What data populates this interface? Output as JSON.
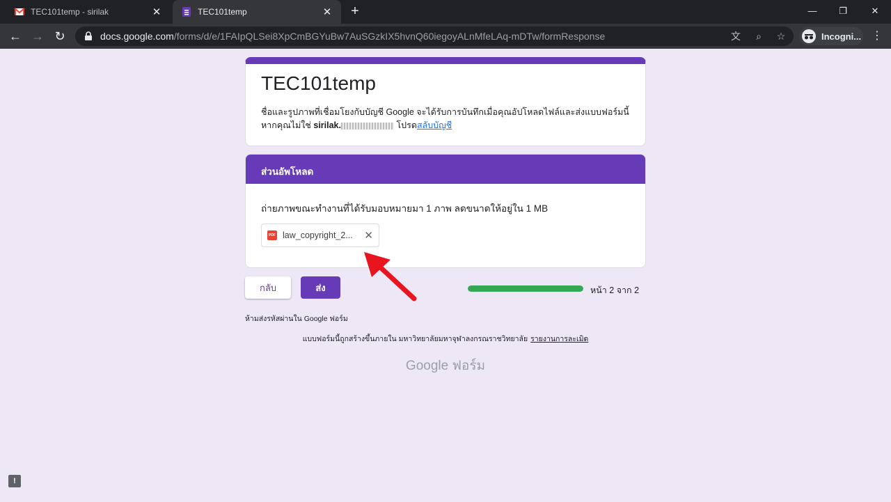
{
  "browser": {
    "tabs": [
      {
        "title": "TEC101temp - sirilak",
        "active": false
      },
      {
        "title": "TEC101temp",
        "active": true
      }
    ],
    "new_tab": "+",
    "url_host": "docs.google.com",
    "url_path": "/forms/d/e/1FAIpQLSei8XpCmBGYuBw7AuSGzkIX5hvnQ60iegoyALnMfeLAq-mDTw/formResponse",
    "profile_label": "Incogni..."
  },
  "form": {
    "title": "TEC101temp",
    "notice_line1": "ชื่อและรูปภาพที่เชื่อมโยงกับบัญชี Google จะได้รับการบันทึกเมื่อคุณอัปโหลดไฟล์และส่งแบบฟอร์มนี้",
    "notice_prefix": "หากคุณไม่ใช่ ",
    "notice_email": "sirilak.",
    "notice_suffix": " โปรด",
    "switch_account": "สลับบัญชี",
    "section_title": "ส่วนอัพโหลด",
    "question": "ถ่ายภาพขณะทำงานที่ได้รับมอบหมายมา 1 ภาพ ลดขนาดให้อยู่ใน 1 MB",
    "file_name": "law_copyright_2...",
    "file_badge": "PDF",
    "back_label": "กลับ",
    "submit_label": "ส่ง",
    "progress_fraction": 1.0,
    "page_indicator": "หน้า 2 จาก 2",
    "never_submit": "ห้ามส่งรหัสผ่านใน Google ฟอร์ม",
    "created_by": "แบบฟอร์มนี้ถูกสร้างขึ้นภายใน มหาวิทยาลัยมหาจุฬาลงกรณราชวิทยาลัย",
    "report_abuse": "รายงานการละเมิด",
    "logo_text": "Google ฟอร์ม"
  },
  "colors": {
    "accent": "#673ab7",
    "progress": "#34a853",
    "arrow": "#e8141e"
  }
}
